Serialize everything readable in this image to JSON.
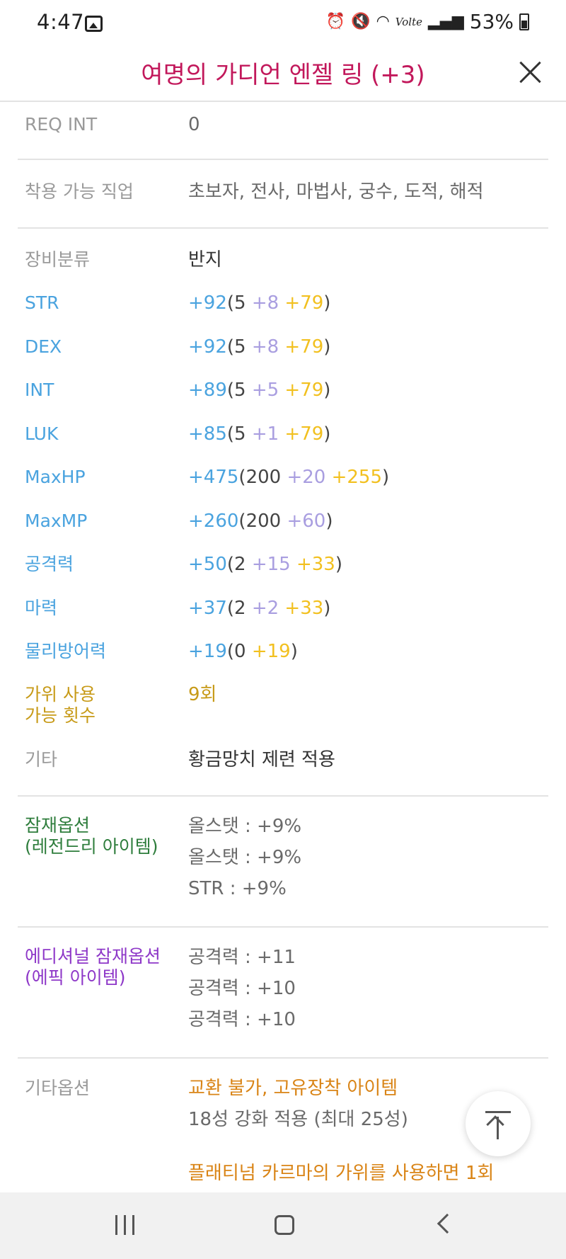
{
  "status_bar": {
    "time": "4:47",
    "battery": "53%",
    "volte": "Volte",
    "icons": [
      "gallery-icon",
      "alarm-icon",
      "mute-icon",
      "wifi-icon",
      "volte-icon",
      "signal-icon",
      "battery-icon"
    ]
  },
  "header": {
    "title": "여명의 가디언 엔젤 링 (+3)",
    "close_icon": "close-icon"
  },
  "req_int": {
    "label": "REQ INT",
    "value": "0"
  },
  "jobs": {
    "label": "착용 가능 직업",
    "value": "초보자, 전사, 마법사, 궁수, 도적, 해적"
  },
  "category": {
    "label": "장비분류",
    "value": "반지"
  },
  "stats": [
    {
      "label": "STR",
      "total": "+92",
      "open": "(5 ",
      "add": "+8",
      "star": " +79",
      "close": ")"
    },
    {
      "label": "DEX",
      "total": "+92",
      "open": "(5 ",
      "add": "+8",
      "star": " +79",
      "close": ")"
    },
    {
      "label": "INT",
      "total": "+89",
      "open": "(5 ",
      "add": "+5",
      "star": " +79",
      "close": ")"
    },
    {
      "label": "LUK",
      "total": "+85",
      "open": "(5 ",
      "add": "+1",
      "star": " +79",
      "close": ")"
    },
    {
      "label": "MaxHP",
      "total": "+475",
      "open": "(200 ",
      "add": "+20",
      "star": " +255",
      "close": ")"
    },
    {
      "label": "MaxMP",
      "total": "+260",
      "open": "(200 ",
      "add": "+60",
      "star": "",
      "close": ")"
    },
    {
      "label": "공격력",
      "total": "+50",
      "open": "(2 ",
      "add": "+15",
      "star": " +33",
      "close": ")"
    },
    {
      "label": "마력",
      "total": "+37",
      "open": "(2 ",
      "add": "+2",
      "star": " +33",
      "close": ")"
    },
    {
      "label": "물리방어력",
      "total": "+19",
      "open": "(0 ",
      "add": "",
      "star": "+19",
      "close": ")"
    }
  ],
  "scissors": {
    "label_line1": "가위 사용",
    "label_line2": "가능 횟수",
    "value": "9회"
  },
  "etc": {
    "label": "기타",
    "value": "황금망치 제련 적용"
  },
  "potential": {
    "label_line1": "잠재옵션",
    "label_line2": "(레전드리 아이템)",
    "lines": [
      "올스탯 : +9%",
      "올스탯 : +9%",
      "STR : +9%"
    ]
  },
  "additional": {
    "label_line1": "에디셔널 잠재옵션",
    "label_line2": "(에픽 아이템)",
    "lines": [
      "공격력 : +11",
      "공격력 : +10",
      "공격력 : +10"
    ]
  },
  "other_options": {
    "label": "기타옵션",
    "line1": "교환 불가, 고유장착 아이템",
    "line2": "18성 강화 적용 (최대 25성)",
    "line3": "플래티넘 카르마의 가위를 사용하면 1회"
  },
  "scroll_top_icon": "arrow-up-icon",
  "nav": {
    "recent_icon": "recent-apps-icon",
    "home_icon": "home-icon",
    "back_icon": "back-icon"
  }
}
